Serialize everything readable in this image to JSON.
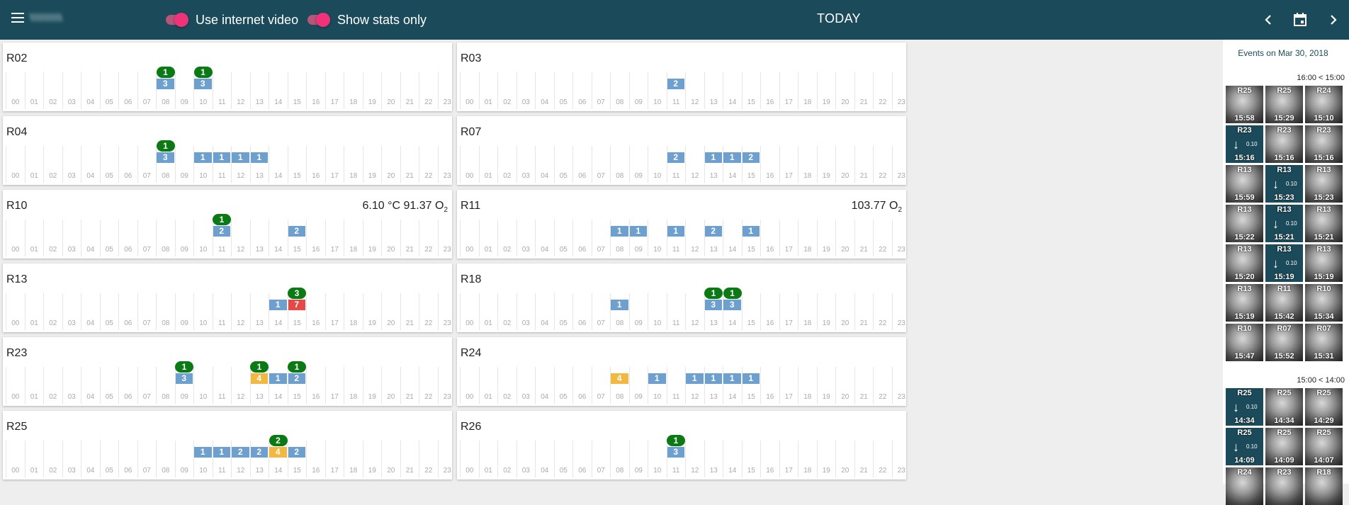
{
  "header": {
    "username": "\\\\\\\\\\\\\\\\\\\\\\",
    "toggle_video_label": "Use internet video",
    "toggle_stats_label": "Show stats only",
    "today_label": "TODAY"
  },
  "hour_labels": [
    "00",
    "01",
    "02",
    "03",
    "04",
    "05",
    "06",
    "07",
    "08",
    "09",
    "10",
    "11",
    "12",
    "13",
    "14",
    "15",
    "16",
    "17",
    "18",
    "19",
    "20",
    "21",
    "22",
    "23"
  ],
  "colors": {
    "header": "#1b4b5a",
    "bar_blue": "#6d9fcf",
    "bar_orange": "#f3b841",
    "bar_red": "#e64945",
    "pill_green": "#0b7a14",
    "toggle_pink": "#f0327a"
  },
  "rooms": [
    {
      "room": "R02",
      "bars": [
        {
          "h": 8,
          "v": "3",
          "c": "blue"
        },
        {
          "h": 10,
          "v": "3",
          "c": "blue"
        }
      ],
      "pills": [
        {
          "h": 8,
          "v": "1"
        },
        {
          "h": 10,
          "v": "1"
        }
      ]
    },
    {
      "room": "R03",
      "bars": [
        {
          "h": 11,
          "v": "2",
          "c": "blue"
        }
      ],
      "pills": []
    },
    {
      "room": "R04",
      "bars": [
        {
          "h": 8,
          "v": "3",
          "c": "blue"
        },
        {
          "h": 10,
          "v": "1",
          "c": "blue"
        },
        {
          "h": 11,
          "v": "1",
          "c": "blue"
        },
        {
          "h": 12,
          "v": "1",
          "c": "blue"
        },
        {
          "h": 13,
          "v": "1",
          "c": "blue"
        }
      ],
      "pills": [
        {
          "h": 8,
          "v": "1"
        }
      ]
    },
    {
      "room": "R07",
      "bars": [
        {
          "h": 11,
          "v": "2",
          "c": "blue"
        },
        {
          "h": 13,
          "v": "1",
          "c": "blue"
        },
        {
          "h": 14,
          "v": "1",
          "c": "blue"
        },
        {
          "h": 15,
          "v": "2",
          "c": "blue"
        }
      ],
      "pills": []
    },
    {
      "room": "R10",
      "metric_value": "6.10 °C 91.37 O",
      "metric_sub": "2",
      "bars": [
        {
          "h": 11,
          "v": "2",
          "c": "blue"
        },
        {
          "h": 15,
          "v": "2",
          "c": "blue"
        }
      ],
      "pills": [
        {
          "h": 11,
          "v": "1"
        }
      ]
    },
    {
      "room": "R11",
      "metric_value": "103.77 O",
      "metric_sub": "2",
      "bars": [
        {
          "h": 8,
          "v": "1",
          "c": "blue"
        },
        {
          "h": 9,
          "v": "1",
          "c": "blue"
        },
        {
          "h": 11,
          "v": "1",
          "c": "blue"
        },
        {
          "h": 13,
          "v": "2",
          "c": "blue"
        },
        {
          "h": 15,
          "v": "1",
          "c": "blue"
        }
      ],
      "pills": []
    },
    {
      "room": "R13",
      "bars": [
        {
          "h": 14,
          "v": "1",
          "c": "blue"
        },
        {
          "h": 15,
          "v": "7",
          "c": "red"
        }
      ],
      "pills": [
        {
          "h": 15,
          "v": "3"
        }
      ]
    },
    {
      "room": "R18",
      "bars": [
        {
          "h": 8,
          "v": "1",
          "c": "blue"
        },
        {
          "h": 13,
          "v": "3",
          "c": "blue"
        },
        {
          "h": 14,
          "v": "3",
          "c": "blue"
        }
      ],
      "pills": [
        {
          "h": 13,
          "v": "1"
        },
        {
          "h": 14,
          "v": "1"
        }
      ]
    },
    {
      "room": "R23",
      "bars": [
        {
          "h": 9,
          "v": "3",
          "c": "blue"
        },
        {
          "h": 13,
          "v": "4",
          "c": "orange"
        },
        {
          "h": 14,
          "v": "1",
          "c": "blue"
        },
        {
          "h": 15,
          "v": "2",
          "c": "blue"
        }
      ],
      "pills": [
        {
          "h": 9,
          "v": "1"
        },
        {
          "h": 13,
          "v": "1"
        },
        {
          "h": 15,
          "v": "1"
        }
      ]
    },
    {
      "room": "R24",
      "bars": [
        {
          "h": 8,
          "v": "4",
          "c": "orange"
        },
        {
          "h": 10,
          "v": "1",
          "c": "blue"
        },
        {
          "h": 12,
          "v": "1",
          "c": "blue"
        },
        {
          "h": 13,
          "v": "1",
          "c": "blue"
        },
        {
          "h": 14,
          "v": "1",
          "c": "blue"
        },
        {
          "h": 15,
          "v": "1",
          "c": "blue"
        }
      ],
      "pills": []
    },
    {
      "room": "R25",
      "bars": [
        {
          "h": 10,
          "v": "1",
          "c": "blue"
        },
        {
          "h": 11,
          "v": "1",
          "c": "blue"
        },
        {
          "h": 12,
          "v": "2",
          "c": "blue"
        },
        {
          "h": 13,
          "v": "2",
          "c": "blue"
        },
        {
          "h": 14,
          "v": "4",
          "c": "orange"
        },
        {
          "h": 15,
          "v": "2",
          "c": "blue"
        }
      ],
      "pills": [
        {
          "h": 14,
          "v": "2"
        }
      ]
    },
    {
      "room": "R26",
      "bars": [
        {
          "h": 11,
          "v": "3",
          "c": "blue"
        }
      ],
      "pills": [
        {
          "h": 11,
          "v": "1"
        }
      ]
    }
  ],
  "sidebar": {
    "title": "Events on Mar 30, 2018",
    "groups": [
      {
        "label": "16:00 < 15:00",
        "thumbs": [
          {
            "r": "R25",
            "t": "15:58"
          },
          {
            "r": "R25",
            "t": "15:29"
          },
          {
            "r": "R24",
            "t": "15:10"
          },
          {
            "r": "R23",
            "t": "15:16",
            "a": true,
            "v": "0.10"
          },
          {
            "r": "R23",
            "t": "15:16"
          },
          {
            "r": "R23",
            "t": "15:16"
          },
          {
            "r": "R13",
            "t": "15:59"
          },
          {
            "r": "R13",
            "t": "15:23",
            "a": true,
            "v": "0.10"
          },
          {
            "r": "R13",
            "t": "15:23"
          },
          {
            "r": "R13",
            "t": "15:22"
          },
          {
            "r": "R13",
            "t": "15:21",
            "a": true,
            "v": "0.10"
          },
          {
            "r": "R13",
            "t": "15:21"
          },
          {
            "r": "R13",
            "t": "15:20"
          },
          {
            "r": "R13",
            "t": "15:19",
            "a": true,
            "v": "0.10"
          },
          {
            "r": "R13",
            "t": "15:19"
          },
          {
            "r": "R13",
            "t": "15:19"
          },
          {
            "r": "R11",
            "t": "15:42"
          },
          {
            "r": "R10",
            "t": "15:34"
          },
          {
            "r": "R10",
            "t": "15:47"
          },
          {
            "r": "R07",
            "t": "15:52"
          },
          {
            "r": "R07",
            "t": "15:31"
          }
        ]
      },
      {
        "label": "15:00 < 14:00",
        "thumbs": [
          {
            "r": "R25",
            "t": "14:34",
            "a": true,
            "v": "0.10"
          },
          {
            "r": "R25",
            "t": "14:34"
          },
          {
            "r": "R25",
            "t": "14:29"
          },
          {
            "r": "R25",
            "t": "14:09",
            "a": true,
            "v": "0.10"
          },
          {
            "r": "R25",
            "t": "14:09"
          },
          {
            "r": "R25",
            "t": "14:07"
          },
          {
            "r": "R24",
            "t": ""
          },
          {
            "r": "R23",
            "t": ""
          },
          {
            "r": "R18",
            "t": ""
          }
        ]
      }
    ]
  }
}
